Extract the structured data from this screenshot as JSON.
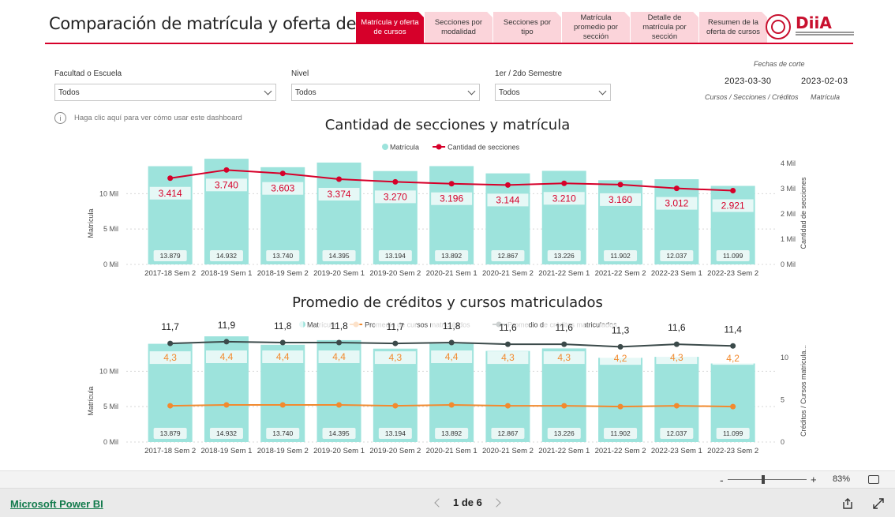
{
  "header": {
    "title": "Comparación de matrícula y oferta de cursos",
    "tabs": [
      {
        "label": "Matrícula y oferta de cursos",
        "active": true
      },
      {
        "label": "Secciones por modalidad"
      },
      {
        "label": "Secciones por tipo"
      },
      {
        "label": "Matrícula promedio por sección"
      },
      {
        "label": "Detalle de matrícula por sección"
      },
      {
        "label": "Resumen de la oferta de cursos"
      }
    ],
    "logo_text": "DiiA",
    "logo_subtitle": "División de Investigación Institucional y Análisis · Dirección de Asuntos Académicos",
    "accent_color": "#d6002a",
    "tab_color": "#fbd4da"
  },
  "filters": [
    {
      "label": "Facultad o Escuela",
      "value": "Todos"
    },
    {
      "label": "Nivel",
      "value": "Todos"
    },
    {
      "label": "1er / 2do Semestre",
      "value": "Todos"
    }
  ],
  "cutoff": {
    "heading": "Fechas de corte",
    "date1": "2023-03-30",
    "date1_caption": "Cursos / Secciones / Créditos",
    "date2": "2023-02-03",
    "date2_caption": "Matrícula"
  },
  "help_text": "Haga clic aquí para ver cómo usar este dashboard",
  "help_icon": "info-icon",
  "chart_data": [
    {
      "type": "bar",
      "title": "Cantidad de secciones y matrícula",
      "categories": [
        "2017-18 Sem 2",
        "2018-19 Sem 1",
        "2018-19 Sem 2",
        "2019-20 Sem 1",
        "2019-20 Sem 2",
        "2020-21 Sem 1",
        "2020-21 Sem 2",
        "2021-22 Sem 1",
        "2021-22 Sem 2",
        "2022-23 Sem 1",
        "2022-23 Sem 2"
      ],
      "series": [
        {
          "name": "Matrícula",
          "kind": "bar",
          "axis": "left",
          "color": "#9de3dc",
          "values": [
            13879,
            14932,
            13740,
            14395,
            13194,
            13892,
            12867,
            13226,
            11902,
            12037,
            11099
          ],
          "labels": [
            "13.879",
            "14.932",
            "13.740",
            "14.395",
            "13.194",
            "13.892",
            "12.867",
            "13.226",
            "11.902",
            "12.037",
            "11.099"
          ]
        },
        {
          "name": "Cantidad de secciones",
          "kind": "line",
          "axis": "right",
          "color": "#d6002a",
          "values": [
            3414,
            3740,
            3603,
            3374,
            3270,
            3196,
            3144,
            3210,
            3160,
            3012,
            2921
          ],
          "labels": [
            "3.414",
            "3.740",
            "3.603",
            "3.374",
            "3.270",
            "3.196",
            "3.144",
            "3.210",
            "3.160",
            "3.012",
            "2.921"
          ]
        }
      ],
      "ylabel": "Matrícula",
      "y2label": "Cantidad de secciones",
      "ylim": [
        0,
        14500
      ],
      "y2lim": [
        0,
        4000
      ],
      "yticks": [
        {
          "v": 0,
          "t": "0 Mil"
        },
        {
          "v": 5000,
          "t": "5 Mil"
        },
        {
          "v": 10000,
          "t": "10 Mil"
        }
      ],
      "y2ticks": [
        {
          "v": 0,
          "t": "0 Mil"
        },
        {
          "v": 1000,
          "t": "1 Mil"
        },
        {
          "v": 2000,
          "t": "2 Mil"
        },
        {
          "v": 3000,
          "t": "3 Mil"
        },
        {
          "v": 4000,
          "t": "4 Mil"
        }
      ],
      "legend": "top-center",
      "grid": true
    },
    {
      "type": "bar",
      "title": "Promedio de créditos y cursos matriculados",
      "categories": [
        "2017-18 Sem 2",
        "2018-19 Sem 1",
        "2018-19 Sem 2",
        "2019-20 Sem 1",
        "2019-20 Sem 2",
        "2020-21 Sem 1",
        "2020-21 Sem 2",
        "2021-22 Sem 1",
        "2021-22 Sem 2",
        "2022-23 Sem 1",
        "2022-23 Sem 2"
      ],
      "series": [
        {
          "name": "Matrícula",
          "kind": "bar",
          "axis": "left",
          "color": "#9de3dc",
          "values": [
            13879,
            14932,
            13740,
            14395,
            13194,
            13892,
            12867,
            13226,
            11902,
            12037,
            11099
          ],
          "labels": [
            "13.879",
            "14.932",
            "13.740",
            "14.395",
            "13.194",
            "13.892",
            "12.867",
            "13.226",
            "11.902",
            "12.037",
            "11.099"
          ]
        },
        {
          "name": "Promedio de cursos matriculados",
          "kind": "line",
          "axis": "right",
          "color": "#f28a2e",
          "values": [
            4.3,
            4.4,
            4.4,
            4.4,
            4.3,
            4.4,
            4.3,
            4.3,
            4.2,
            4.3,
            4.2
          ],
          "labels": [
            "4,3",
            "4,4",
            "4,4",
            "4,4",
            "4,3",
            "4,4",
            "4,3",
            "4,3",
            "4,2",
            "4,3",
            "4,2"
          ]
        },
        {
          "name": "Promedio de créditos matriculados",
          "kind": "line",
          "axis": "right",
          "color": "#3b4a4a",
          "values": [
            11.7,
            11.9,
            11.8,
            11.8,
            11.7,
            11.8,
            11.6,
            11.6,
            11.3,
            11.6,
            11.4
          ],
          "labels": [
            "11,7",
            "11,9",
            "11,8",
            "11,8",
            "11,7",
            "11,8",
            "11,6",
            "11,6",
            "11,3",
            "11,6",
            "11,4"
          ]
        }
      ],
      "ylabel": "Matrícula",
      "y2label": "Créditos / Cursos matricula...",
      "ylim": [
        0,
        14500
      ],
      "y2lim": [
        0,
        11.8
      ],
      "yticks": [
        {
          "v": 0,
          "t": "0 Mil"
        },
        {
          "v": 5000,
          "t": "5 Mil"
        },
        {
          "v": 10000,
          "t": "10 Mil"
        }
      ],
      "y2ticks": [
        {
          "v": 0,
          "t": "0"
        },
        {
          "v": 5,
          "t": "5"
        },
        {
          "v": 10,
          "t": "10"
        }
      ],
      "legend": "top-center",
      "grid": true
    }
  ],
  "bottom_bar": {
    "zoom_minus": "-",
    "zoom_plus": "+",
    "zoom_level": "83%",
    "zoom_fraction": 0.45,
    "fit_icon": "fit-to-page-icon"
  },
  "footer": {
    "brand": "Microsoft Power BI",
    "page_indicator": "1 de 6",
    "prev_icon": "chevron-left-icon",
    "next_icon": "chevron-right-icon",
    "share_icon": "share-icon",
    "fullscreen_icon": "expand-icon"
  }
}
